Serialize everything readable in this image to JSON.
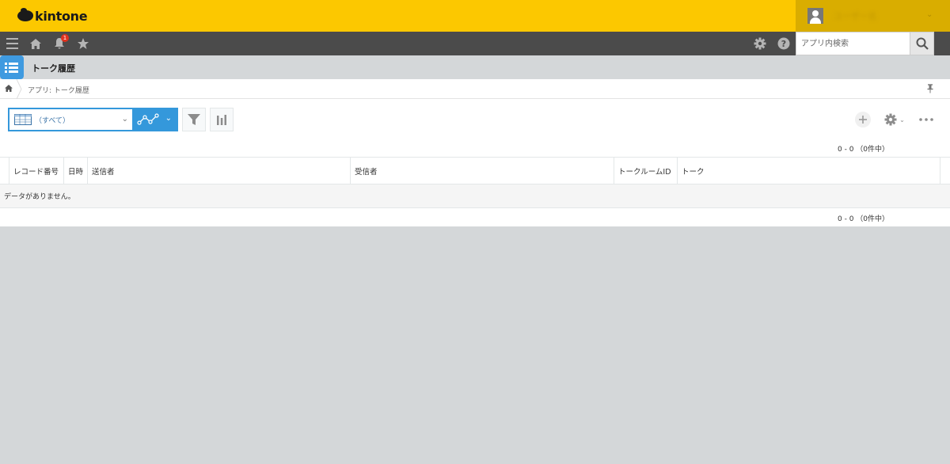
{
  "brand": {
    "name": "kintone"
  },
  "user": {
    "name": "ユーザー名"
  },
  "navbar": {
    "notification_count": "1",
    "search_placeholder": "アプリ内検索"
  },
  "app": {
    "title": "トーク履歴"
  },
  "breadcrumb": {
    "text": "アプリ: トーク履歴"
  },
  "toolbar": {
    "view_label": "（すべて）"
  },
  "pagination": {
    "top": "0 - 0 （0件中）",
    "bottom": "0 - 0 （0件中）"
  },
  "table": {
    "columns": [
      "レコード番号",
      "日時",
      "送信者",
      "受信者",
      "トークルームID",
      "トーク"
    ],
    "empty_message": "データがありません。"
  },
  "colors": {
    "header_yellow": "#fcc800",
    "user_area": "#d9ad00",
    "navbar": "#4b4b4b",
    "accent_blue": "#3498db",
    "background": "#d4d7d9"
  }
}
